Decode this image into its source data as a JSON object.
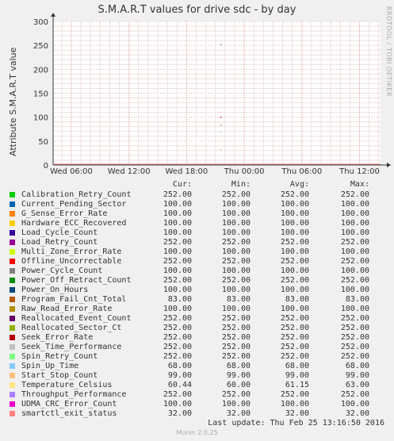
{
  "title": "S.M.A.R.T values for drive sdc - by day",
  "credit": "RRDTOOL / TOBI OETIKER",
  "footer": "Munin 2.0.25",
  "last_update": "Last update:  Thu Feb 25 13:16:50 2016",
  "headers": {
    "cur": "Cur:",
    "min": "Min:",
    "avg": "Avg:",
    "max": "Max:"
  },
  "chart_data": {
    "type": "line",
    "title": "S.M.A.R.T values for drive sdc - by day",
    "xlabel": "",
    "ylabel": "Attribute S.M.A.R.T value",
    "ylim": [
      0,
      300
    ],
    "yticks": [
      "0",
      "50",
      "100",
      "150",
      "200",
      "250",
      "300"
    ],
    "xticks": [
      "Wed 06:00",
      "Wed 12:00",
      "Wed 18:00",
      "Thu 00:00",
      "Thu 06:00",
      "Thu 12:00"
    ],
    "grid": true,
    "series": [
      {
        "name": "Calibration_Retry_Count",
        "color": "#00cc00",
        "cur": "252.00",
        "min": "252.00",
        "avg": "252.00",
        "max": "252.00"
      },
      {
        "name": "Current_Pending_Sector",
        "color": "#0066b3",
        "cur": "100.00",
        "min": "100.00",
        "avg": "100.00",
        "max": "100.00"
      },
      {
        "name": "G_Sense_Error_Rate",
        "color": "#ff8000",
        "cur": "100.00",
        "min": "100.00",
        "avg": "100.00",
        "max": "100.00"
      },
      {
        "name": "Hardware_ECC_Recovered",
        "color": "#ffcc00",
        "cur": "100.00",
        "min": "100.00",
        "avg": "100.00",
        "max": "100.00"
      },
      {
        "name": "Load_Cycle_Count",
        "color": "#330099",
        "cur": "100.00",
        "min": "100.00",
        "avg": "100.00",
        "max": "100.00"
      },
      {
        "name": "Load_Retry_Count",
        "color": "#990099",
        "cur": "252.00",
        "min": "252.00",
        "avg": "252.00",
        "max": "252.00"
      },
      {
        "name": "Multi_Zone_Error_Rate",
        "color": "#ccff00",
        "cur": "100.00",
        "min": "100.00",
        "avg": "100.00",
        "max": "100.00"
      },
      {
        "name": "Offline_Uncorrectable",
        "color": "#ff0000",
        "cur": "252.00",
        "min": "252.00",
        "avg": "252.00",
        "max": "252.00"
      },
      {
        "name": "Power_Cycle_Count",
        "color": "#808080",
        "cur": "100.00",
        "min": "100.00",
        "avg": "100.00",
        "max": "100.00"
      },
      {
        "name": "Power_Off_Retract_Count",
        "color": "#008f00",
        "cur": "252.00",
        "min": "252.00",
        "avg": "252.00",
        "max": "252.00"
      },
      {
        "name": "Power_On_Hours",
        "color": "#00487d",
        "cur": "100.00",
        "min": "100.00",
        "avg": "100.00",
        "max": "100.00"
      },
      {
        "name": "Program_Fail_Cnt_Total",
        "color": "#b35a00",
        "cur": "83.00",
        "min": "83.00",
        "avg": "83.00",
        "max": "83.00"
      },
      {
        "name": "Raw_Read_Error_Rate",
        "color": "#b38f00",
        "cur": "100.00",
        "min": "100.00",
        "avg": "100.00",
        "max": "100.00"
      },
      {
        "name": "Reallocated_Event_Count",
        "color": "#6b006b",
        "cur": "252.00",
        "min": "252.00",
        "avg": "252.00",
        "max": "252.00"
      },
      {
        "name": "Reallocated_Sector_Ct",
        "color": "#8fb300",
        "cur": "252.00",
        "min": "252.00",
        "avg": "252.00",
        "max": "252.00"
      },
      {
        "name": "Seek_Error_Rate",
        "color": "#b30000",
        "cur": "252.00",
        "min": "252.00",
        "avg": "252.00",
        "max": "252.00"
      },
      {
        "name": "Seek_Time_Performance",
        "color": "#bebebe",
        "cur": "252.00",
        "min": "252.00",
        "avg": "252.00",
        "max": "252.00"
      },
      {
        "name": "Spin_Retry_Count",
        "color": "#80ff80",
        "cur": "252.00",
        "min": "252.00",
        "avg": "252.00",
        "max": "252.00"
      },
      {
        "name": "Spin_Up_Time",
        "color": "#80c9ff",
        "cur": "68.00",
        "min": "68.00",
        "avg": "68.00",
        "max": "68.00"
      },
      {
        "name": "Start_Stop_Count",
        "color": "#ffc080",
        "cur": "99.00",
        "min": "99.00",
        "avg": "99.00",
        "max": "99.00"
      },
      {
        "name": "Temperature_Celsius",
        "color": "#ffe680",
        "cur": "60.44",
        "min": "60.00",
        "avg": "61.15",
        "max": "63.00"
      },
      {
        "name": "Throughput_Performance",
        "color": "#aa80ff",
        "cur": "252.00",
        "min": "252.00",
        "avg": "252.00",
        "max": "252.00"
      },
      {
        "name": "UDMA_CRC_Error_Count",
        "color": "#ee00cc",
        "cur": "100.00",
        "min": "100.00",
        "avg": "100.00",
        "max": "100.00"
      },
      {
        "name": "smartctl_exit_status",
        "color": "#ff8080",
        "cur": "32.00",
        "min": "32.00",
        "avg": "32.00",
        "max": "32.00"
      }
    ]
  }
}
